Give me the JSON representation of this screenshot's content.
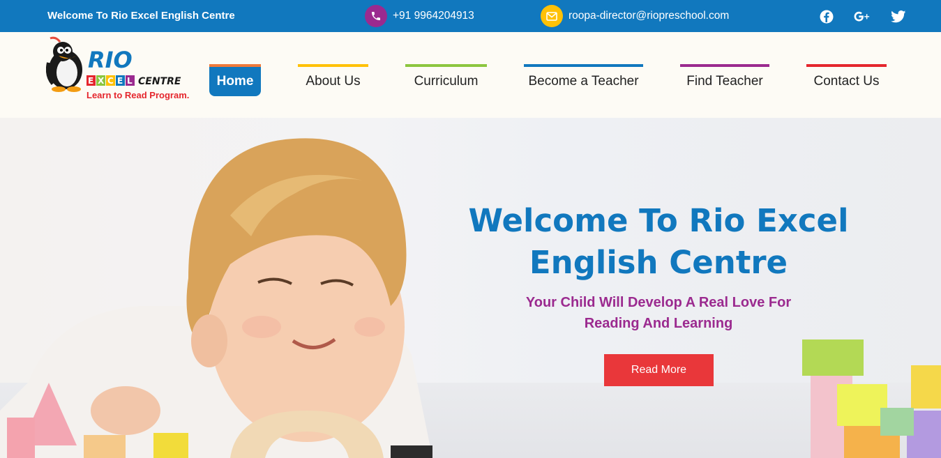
{
  "topbar": {
    "welcome": "Welcome To Rio Excel English Centre",
    "phone": "+91 9964204913",
    "email": "roopa-director@riopreschool.com",
    "social": [
      "facebook-icon",
      "google-plus-icon",
      "twitter-icon"
    ]
  },
  "logo": {
    "rio": "RIO",
    "excel_letters": [
      "E",
      "X",
      "C",
      "E",
      "L"
    ],
    "centre": "CENTRE",
    "tagline": "Learn to Read Program."
  },
  "nav": [
    {
      "label": "Home",
      "color": "#f07a3a",
      "active": true
    },
    {
      "label": "About Us",
      "color": "#ffc107"
    },
    {
      "label": "Curriculum",
      "color": "#8cc63f"
    },
    {
      "label": "Become a Teacher",
      "color": "#1178be"
    },
    {
      "label": "Find Teacher",
      "color": "#9b2a8f"
    },
    {
      "label": "Contact Us",
      "color": "#e5262d"
    }
  ],
  "hero": {
    "title_line1": "Welcome To Rio Excel",
    "title_line2": "English Centre",
    "subtitle_line1": "Your Child Will Develop A Real Love For",
    "subtitle_line2": "Reading And Learning",
    "button": "Read More"
  },
  "colors": {
    "primary": "#1178be",
    "purple": "#9b2a8f",
    "yellow": "#ffc107",
    "red": "#e9373a"
  }
}
